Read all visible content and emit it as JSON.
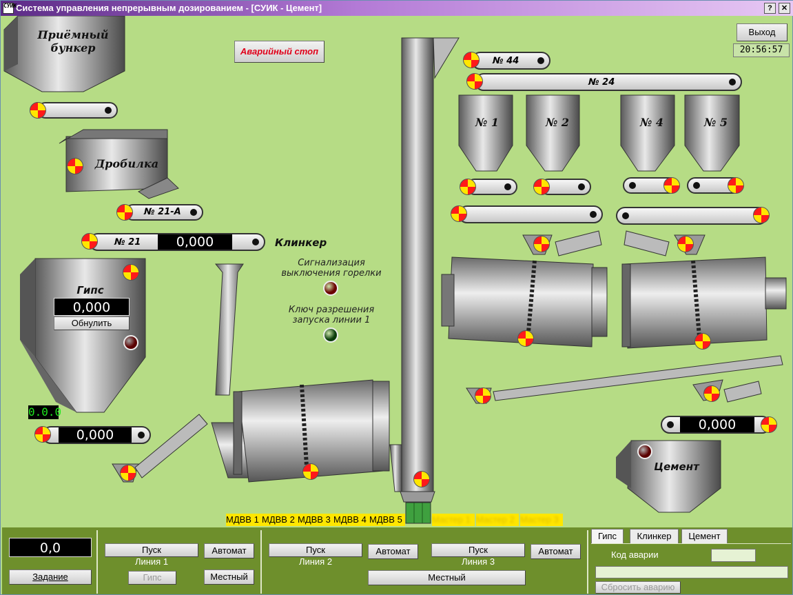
{
  "window": {
    "title": "Система управления непрерывным дозированием - [СУИК - Цемент]",
    "help_button": "?",
    "close_button": "✕",
    "app_icon_text": "СУИК"
  },
  "header": {
    "exit_button": "Выход",
    "clock": "20:56:57",
    "emergency_stop": "Аварийный стоп"
  },
  "bins": {
    "receiving": "Приёмный бункер",
    "crusher": "Дробилка",
    "gypsum": "Гипс",
    "gypsum_value": "0,000",
    "gypsum_reset": "Обнулить",
    "gypsum_counter": "0.0.0",
    "gypsum_feeder_value": "0,000",
    "cement": "Цемент",
    "cement_feeder_value": "0,000",
    "silo_1": "№ 1",
    "silo_2": "№ 2",
    "silo_4": "№ 4",
    "silo_5": "№ 5"
  },
  "conveyors": {
    "c44": "№ 44",
    "c24": "№ 24",
    "c21a": "№ 21-А",
    "c21": "№ 21",
    "c21_value": "0,000",
    "clinker_label": "Клинкер"
  },
  "signals": {
    "burner_off": "Сигнализация выключения горелки",
    "line1_key": "Ключ разрешения запуска линии 1",
    "burner_lamp_color": "#6b0000",
    "line1_lamp_color": "#0b3d0b",
    "gypsum_lamp_color": "#5a0000",
    "cement_lamp_color": "#5a0000"
  },
  "mdvv": [
    "МДВВ 1",
    "МДВВ 2",
    "МДВВ 3",
    "МДВВ 4",
    "МДВВ 5"
  ],
  "masters": [
    "Мастер 1",
    "Мастер 2",
    "Мастер 3"
  ],
  "master_numbers": [
    "1",
    "2",
    "3"
  ],
  "panel": {
    "setpoint_value": "0,0",
    "setpoint_button": "Задание",
    "line1": {
      "start": "Пуск",
      "name": "Линия 1",
      "auto": "Автомат",
      "gypsum": "Гипс",
      "local": "Местный"
    },
    "line2": {
      "start": "Пуск",
      "name": "Линия 2",
      "auto": "Автомат"
    },
    "line3": {
      "start": "Пуск",
      "name": "Линия 3",
      "auto": "Автомат"
    },
    "local_23": "Местный",
    "tabs": [
      "Гипс",
      "Клинкер",
      "Цемент"
    ],
    "alarm_code_label": "Код аварии",
    "alarm_code_value": "",
    "alarm_message": "",
    "reset_alarm": "Сбросить аварию"
  }
}
